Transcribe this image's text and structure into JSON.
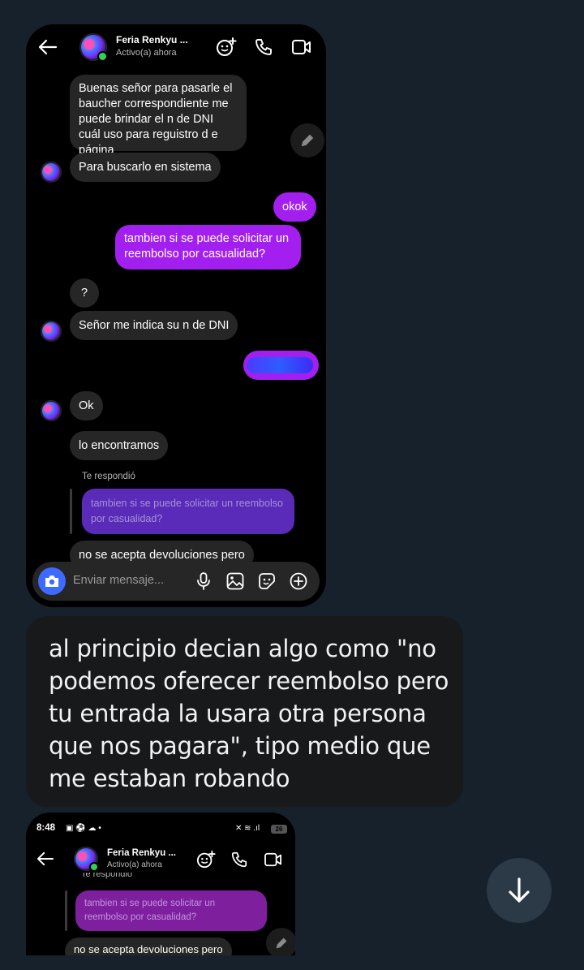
{
  "chat_top": {
    "contact_name": "Feria Renkyu ...",
    "contact_status": "Activo(a) ahora",
    "icons": [
      "back-arrow-icon",
      "effects-icon",
      "phone-icon",
      "video-icon"
    ],
    "messages": [
      {
        "side": "in",
        "text": "Buenas señor para pasarle el baucher correspondiente me puede brindar el n de DNI cuál uso para reguistro d e página"
      },
      {
        "side": "in",
        "text": "Para buscarlo en sistema"
      },
      {
        "side": "out",
        "text": "okok"
      },
      {
        "side": "out",
        "text": "tambien si se puede solicitar un reembolso por casualidad?"
      },
      {
        "side": "in",
        "text": "?"
      },
      {
        "side": "in",
        "text": "Señor me indica su n de DNI"
      },
      {
        "side": "out",
        "text": ""
      },
      {
        "side": "in",
        "text": "Ok"
      },
      {
        "side": "in",
        "text": "lo encontramos"
      },
      {
        "side": "in",
        "text": "no se acepta devoluciones  pero"
      }
    ],
    "reply_label": "Te respondió",
    "reply_quote": "tambien si se puede solicitar un reembolso por casualidad?",
    "composer_placeholder": "Enviar mensaje..."
  },
  "caption": {
    "text": "al principio decian algo como \"no podemos oferecer reembolso pero tu entrada la usara otra persona que nos pagara\", tipo medio que me estaban robando"
  },
  "chat_bottom": {
    "status_time": "8:48",
    "battery": "26",
    "contact_name": "Feria Renkyu ...",
    "contact_status": "Activo(a) ahora",
    "reply_label": "Te respondió",
    "reply_quote": "tambien si se puede solicitar un reembolso por casualidad?",
    "message_text": "no se acepta devoluciones  pero"
  },
  "colors": {
    "page_background": "#17212b",
    "incoming_bubble": "#262626",
    "outgoing_bubble": "#a31ff0",
    "reply_quote": "#5a2bb8",
    "online_dot": "#2ed158"
  }
}
